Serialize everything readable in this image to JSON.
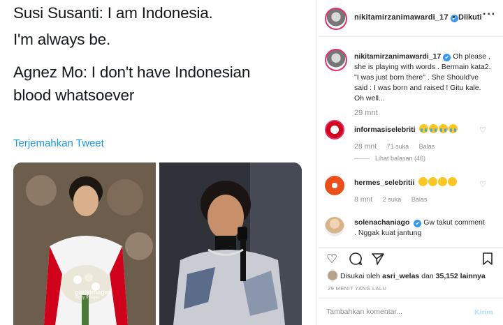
{
  "tweet": {
    "line1": "Susi Susanti: I am Indonesia.",
    "line2": "I'm always be.",
    "line3": "Agnez Mo: I don't have Indonesian",
    "line4": "blood whatsoever",
    "translate": "Terjemahkan Tweet"
  },
  "photos": {
    "watermark": "gettyimages",
    "watermark_sub": "Getty Images"
  },
  "header": {
    "username": "nikitamirzanimawardi_17",
    "verified": "✔",
    "separator": "•",
    "follow_status": "Diikuti",
    "more": "···"
  },
  "caption": {
    "username": "nikitamirzanimawardi_17",
    "text": "Oh please , she is playing with words . Bermain kata2. \"I was just born there\" . She Should've said : I was born and raised ! Gitu kale. Oh well...",
    "time": "29 mnt"
  },
  "comments": [
    {
      "username": "informasiselebriti",
      "time": "28 mnt",
      "likes": "71 suka",
      "reply": "Balas",
      "view_replies": "Lihat balasan (46)"
    },
    {
      "username": "hermes_selebritii",
      "time": "8 mnt",
      "likes": "2 suka",
      "reply": "Balas"
    },
    {
      "username": "solenachaniago",
      "text": "Gw takut comment . Nggak kuat jantung"
    }
  ],
  "likes": {
    "prefix": "Disukai oleh",
    "user": "asri_welas",
    "middle": "dan",
    "count": "35,152 lainnya"
  },
  "post_time": "29 MENIT YANG LALU",
  "add_comment": {
    "placeholder": "Tambahkan komentar...",
    "send_label": "Kirim"
  }
}
